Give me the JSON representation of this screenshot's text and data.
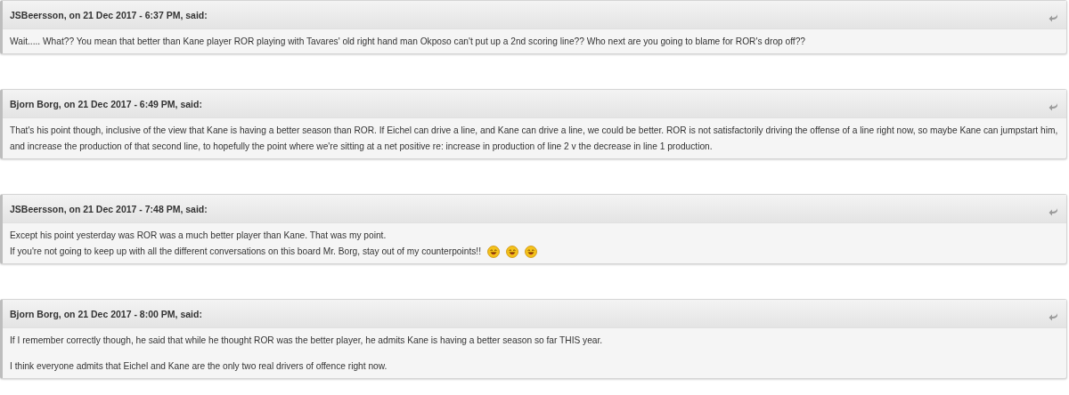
{
  "quotes": [
    {
      "citation": "JSBeersson, on 21 Dec 2017 - 6:37 PM, said:",
      "blocks": [
        [
          {
            "text": "Wait..... What?? You mean that better than Kane player ROR playing with Tavares' old right hand man Okposo can't put up a 2nd scoring line?? Who next are you going to blame for ROR's drop off??"
          }
        ]
      ]
    },
    {
      "citation": "Bjorn Borg, on 21 Dec 2017 - 6:49 PM, said:",
      "blocks": [
        [
          {
            "text": "That's his point though, inclusive of the view that Kane is having a better season than ROR. If Eichel can drive a line, and Kane can drive a line, we could be better. ROR is not satisfactorily driving the offense of a line right now, so maybe Kane can jumpstart him, and increase the production of that second line, to hopefully the point where we're sitting at a net positive re: increase in production of line 2 v the decrease in line 1 production."
          }
        ]
      ]
    },
    {
      "citation": "JSBeersson, on 21 Dec 2017 - 7:48 PM, said:",
      "blocks": [
        [
          {
            "text": "Except his point yesterday was ROR was a much better player than Kane. That was my point."
          },
          {
            "text": "If you're not going to keep up with all the different conversations on this board Mr. Borg, stay out of my counterpoints!!",
            "icons": [
              {
                "kind": "emoticon"
              },
              {
                "kind": "emoticon"
              },
              {
                "kind": "emoticon"
              }
            ]
          }
        ]
      ]
    },
    {
      "citation": "Bjorn Borg, on 21 Dec 2017 - 8:00 PM, said:",
      "blocks": [
        [
          {
            "text": "If I remember correctly though, he said that while he thought ROR was the better player, he admits Kane is having a better season so far THIS year."
          }
        ],
        [
          {
            "text": "I think everyone admits that Eichel and Kane are the only two real drivers of offence right now."
          }
        ]
      ]
    }
  ]
}
